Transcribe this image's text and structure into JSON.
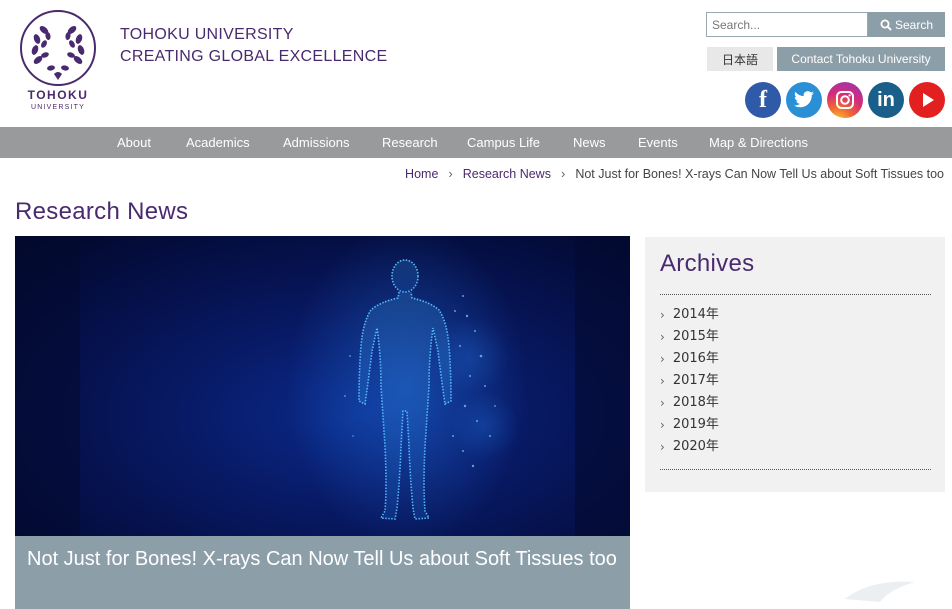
{
  "header": {
    "logo_text": "TOHOKU",
    "logo_subtext": "UNIVERSITY",
    "title_line1": "TOHOKU UNIVERSITY",
    "title_line2": "CREATING GLOBAL EXCELLENCE"
  },
  "search": {
    "placeholder": "Search...",
    "button_label": "Search"
  },
  "utility": {
    "language_label": "日本語",
    "contact_label": "Contact Tohoku University"
  },
  "social": {
    "facebook": "f",
    "linkedin": "in",
    "icons": [
      "facebook-icon",
      "twitter-icon",
      "instagram-icon",
      "linkedin-icon",
      "youtube-icon"
    ]
  },
  "nav": {
    "items": [
      "About",
      "Academics",
      "Admissions",
      "Research",
      "Campus Life",
      "News",
      "Events",
      "Map & Directions"
    ]
  },
  "breadcrumb": {
    "home": "Home",
    "section": "Research News",
    "current": "Not Just for Bones! X-rays Can Now Tell Us about Soft Tissues too"
  },
  "page": {
    "title": "Research News"
  },
  "article": {
    "headline": "Not Just for Bones! X-rays Can Now Tell Us about Soft Tissues too"
  },
  "sidebar": {
    "title": "Archives",
    "items": [
      "2014年",
      "2015年",
      "2016年",
      "2017年",
      "2018年",
      "2019年",
      "2020年"
    ]
  },
  "colors": {
    "brand_purple": "#4a2a6e",
    "nav_gray": "#999a9b",
    "accent_slate": "#8c9ea8"
  }
}
